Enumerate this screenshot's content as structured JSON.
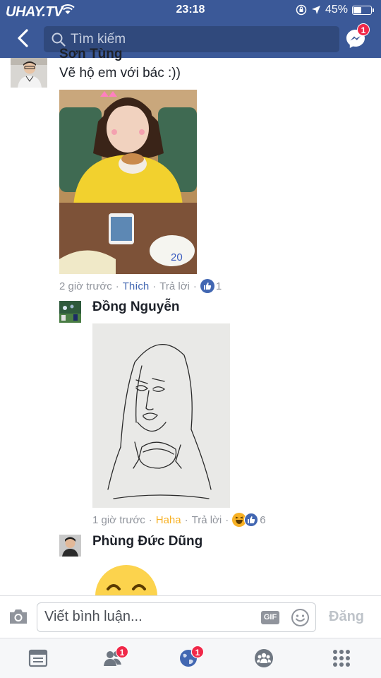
{
  "status_bar": {
    "watermark": "UHAY.TV",
    "time": "23:18",
    "battery": "45%"
  },
  "header": {
    "search_placeholder": "Tìm kiếm",
    "messenger_badge": "1"
  },
  "comments": [
    {
      "author": "Sơn Tùng",
      "text": "Vẽ hộ em với bác :))",
      "time": "2 giờ trước",
      "reaction_action": "Thích",
      "reply": "Trả lời",
      "reaction_count": "1",
      "reactions": [
        "like-icon"
      ]
    },
    {
      "author": "Đồng Nguyễn",
      "time": "1 giờ trước",
      "reaction_action": "Haha",
      "reply": "Trả lời",
      "reaction_count": "6",
      "reactions": [
        "haha-icon",
        "like-icon"
      ]
    },
    {
      "author": "Phùng Đức Dũng"
    }
  ],
  "composer": {
    "placeholder": "Viết bình luận...",
    "gif_label": "GIF",
    "post_label": "Đăng"
  },
  "tabbar": {
    "friends_badge": "1",
    "notifications_badge": "1"
  },
  "colors": {
    "brand": "#3b5998",
    "link": "#4267b2",
    "haha": "#f7b125",
    "badge": "#f02849",
    "meta": "#90949c"
  }
}
